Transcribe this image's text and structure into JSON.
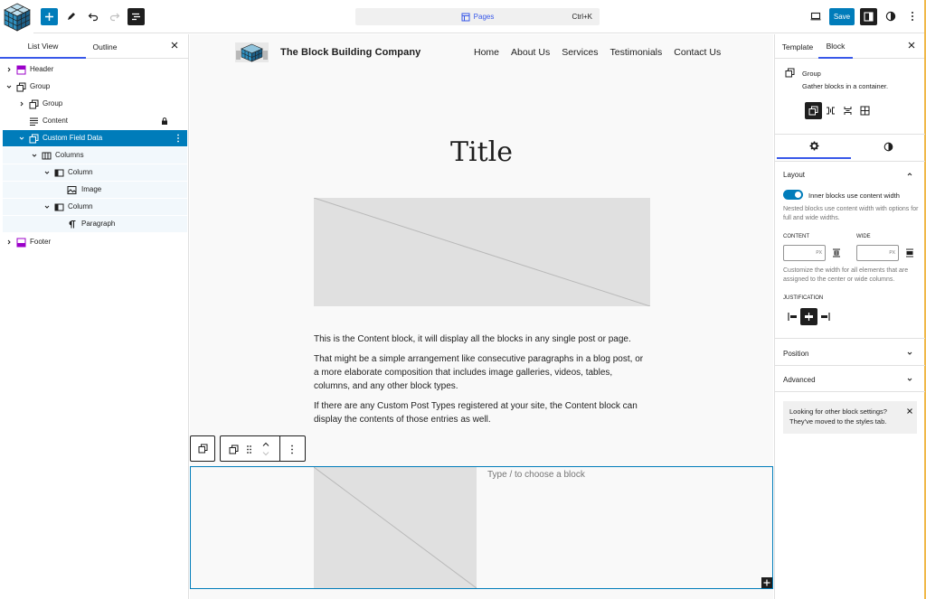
{
  "topbar": {
    "command_title": "Pages",
    "command_shortcut": "Ctrl+K",
    "save_label": "Save"
  },
  "listview": {
    "tabs": [
      "List View",
      "Outline"
    ],
    "items": [
      {
        "label": "Header",
        "icon": "template-part-icon"
      },
      {
        "label": "Group",
        "icon": "group-icon"
      },
      {
        "label": "Group",
        "icon": "group-icon"
      },
      {
        "label": "Content",
        "icon": "post-content-icon"
      },
      {
        "label": "Custom Field Data",
        "icon": "group-icon"
      },
      {
        "label": "Columns",
        "icon": "columns-icon"
      },
      {
        "label": "Column",
        "icon": "column-icon"
      },
      {
        "label": "Image",
        "icon": "image-icon"
      },
      {
        "label": "Column",
        "icon": "column-icon"
      },
      {
        "label": "Paragraph",
        "icon": "paragraph-icon"
      },
      {
        "label": "Footer",
        "icon": "template-part-icon"
      }
    ]
  },
  "canvas": {
    "site_title": "The Block Building Company",
    "nav": [
      "Home",
      "About Us",
      "Services",
      "Testimonials",
      "Contact Us"
    ],
    "post_title": "Title",
    "content_paragraphs": [
      "This is the Content block, it will display all the blocks in any single post or page.",
      "That might be a simple arrangement like consecutive paragraphs in a blog post, or a more elaborate composition that includes image galleries, videos, tables, columns, and any other block types.",
      "If there are any Custom Post Types registered at your site, the Content block can display the contents of those entries as well."
    ],
    "type_hint": "Type / to choose a block"
  },
  "settings": {
    "tabs": [
      "Template",
      "Block"
    ],
    "block_name": "Group",
    "block_description": "Gather blocks in a container.",
    "layout_title": "Layout",
    "toggle_label": "Inner blocks use content width",
    "toggle_on": true,
    "toggle_help": "Nested blocks use content width with options for full and wide widths.",
    "content_label": "CONTENT",
    "wide_label": "WIDE",
    "unit": "PX",
    "width_help": "Customize the width for all elements that are assigned to the center or wide columns.",
    "justification_label": "JUSTIFICATION",
    "position_title": "Position",
    "advanced_title": "Advanced",
    "notice": "Looking for other block settings? They've moved to the styles tab."
  },
  "colors": {
    "accent": "#007cba",
    "admin": "#3858e9",
    "template_part": "#9b00c9",
    "dark": "#1e1e1e",
    "placeholder": "#e0e0e0"
  }
}
